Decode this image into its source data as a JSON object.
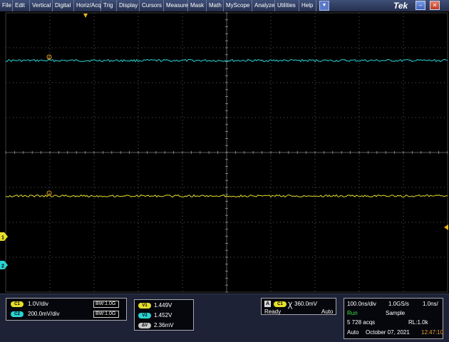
{
  "menu": {
    "items": [
      "File",
      "Edit",
      "Vertical",
      "Digital",
      "Horiz/Acq",
      "Trig",
      "Display",
      "Cursors",
      "Measure",
      "Mask",
      "Math",
      "MyScope",
      "Analyze",
      "Utilities",
      "Help"
    ],
    "logo": "Tek"
  },
  "markers": {
    "ch1": "1",
    "ch2": "2",
    "cursor_a": "a",
    "cursor_b": "b"
  },
  "colors": {
    "ch1": "#e6df2a",
    "ch2": "#2ad3d3"
  },
  "channels": [
    {
      "chip": "C1",
      "scale": "1.0V/div",
      "bw": "1.0G"
    },
    {
      "chip": "C2",
      "scale": "200.0mV/div",
      "bw": "1.0G"
    }
  ],
  "bw_label": "BW",
  "cursors": [
    {
      "label": "V1",
      "value": "1.449V"
    },
    {
      "label": "V2",
      "value": "1.452V"
    },
    {
      "label": "ΔV",
      "value": "2.36mV"
    }
  ],
  "trigger": {
    "badge": "A",
    "chip": "C1",
    "level": "360.0mV",
    "state": "Ready",
    "mode": "Auto"
  },
  "acquisition": {
    "timebase": "100.0ns/div",
    "sample_rate": "1.0GS/s",
    "resolution": "1.0ns/",
    "status": "Run",
    "acq_mode": "Sample",
    "acqs": "5 728 acqs",
    "record_length": "RL:1.0k",
    "trigger_mode": "Auto",
    "date": "October 07, 2021",
    "time": "12:47:10"
  }
}
